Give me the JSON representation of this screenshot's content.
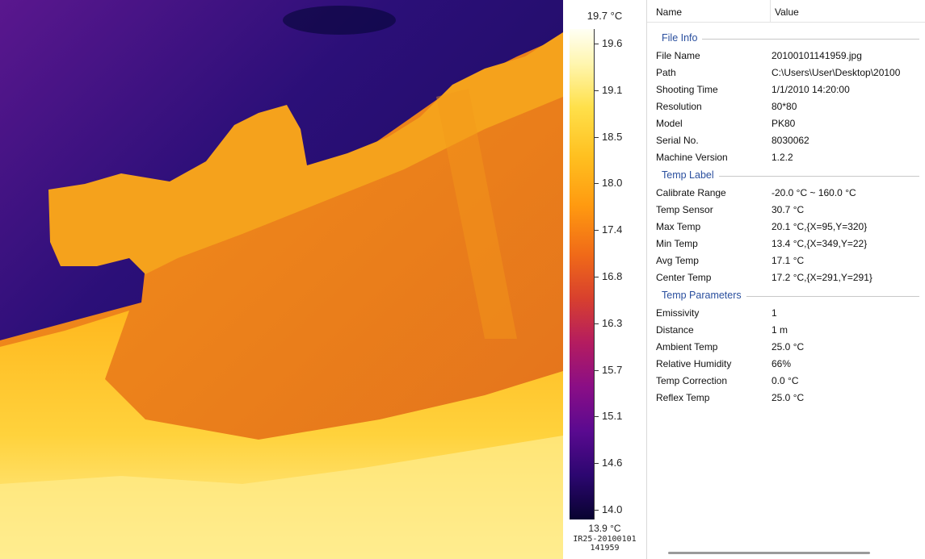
{
  "scale": {
    "max_label": "19.7 °C",
    "min_label": "13.9 °C",
    "ticks": [
      "19.6",
      "19.1",
      "18.5",
      "18.0",
      "17.4",
      "16.8",
      "16.3",
      "15.7",
      "15.1",
      "14.6",
      "14.0"
    ],
    "caption_line1": "IR25-20100101",
    "caption_line2": "141959"
  },
  "table": {
    "header_name": "Name",
    "header_value": "Value"
  },
  "groups": [
    {
      "title": "File Info",
      "rows": [
        {
          "name": "File Name",
          "value": "20100101141959.jpg"
        },
        {
          "name": "Path",
          "value": "C:\\Users\\User\\Desktop\\20100"
        },
        {
          "name": "Shooting Time",
          "value": "1/1/2010 14:20:00"
        },
        {
          "name": "Resolution",
          "value": "80*80"
        },
        {
          "name": "Model",
          "value": "PK80"
        },
        {
          "name": "Serial No.",
          "value": "8030062"
        },
        {
          "name": "Machine Version",
          "value": "1.2.2"
        }
      ]
    },
    {
      "title": "Temp Label",
      "rows": [
        {
          "name": "Calibrate Range",
          "value": "-20.0 °C ~ 160.0 °C"
        },
        {
          "name": "Temp Sensor",
          "value": "30.7 °C"
        },
        {
          "name": "Max Temp",
          "value": "20.1 °C,{X=95,Y=320}"
        },
        {
          "name": "Min Temp",
          "value": "13.4 °C,{X=349,Y=22}"
        },
        {
          "name": "Avg Temp",
          "value": "17.1 °C"
        },
        {
          "name": "Center Temp",
          "value": "17.2 °C,{X=291,Y=291}"
        }
      ]
    },
    {
      "title": "Temp Parameters",
      "rows": [
        {
          "name": "Emissivity",
          "value": "1"
        },
        {
          "name": "Distance",
          "value": "1 m"
        },
        {
          "name": "Ambient Temp",
          "value": "25.0 °C"
        },
        {
          "name": "Relative Humidity",
          "value": "66%"
        },
        {
          "name": "Temp Correction",
          "value": "0.0 °C"
        },
        {
          "name": "Reflex Temp",
          "value": "25.0 °C"
        }
      ]
    }
  ],
  "colors": {
    "group_title": "#2a4f9e",
    "palette_hot": "#fffff4",
    "palette_mid": "#f07a10",
    "palette_cold": "#2a0d6a"
  }
}
